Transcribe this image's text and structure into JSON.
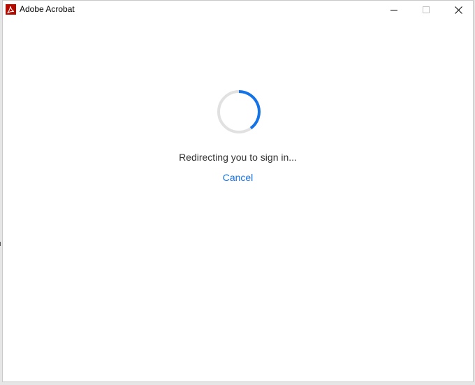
{
  "window": {
    "title": "Adobe Acrobat"
  },
  "controls": {
    "minimize_icon": "minimize-icon",
    "maximize_icon": "maximize-icon",
    "close_icon": "close-icon"
  },
  "main": {
    "status": "Redirecting you to sign in...",
    "cancel_label": "Cancel",
    "spinner_progress": 0.4
  },
  "colors": {
    "accent": "#1473e6",
    "brand": "#b30b00",
    "spinner_track": "#e1e1e1"
  }
}
